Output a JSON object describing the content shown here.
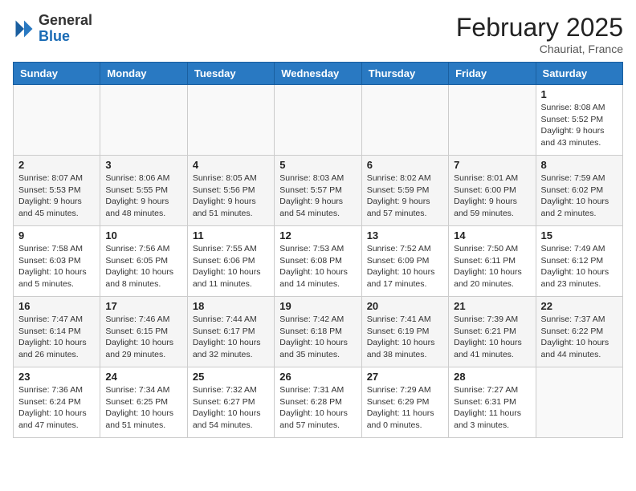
{
  "header": {
    "logo": {
      "general": "General",
      "blue": "Blue"
    },
    "title": "February 2025",
    "location": "Chauriat, France"
  },
  "weekdays": [
    "Sunday",
    "Monday",
    "Tuesday",
    "Wednesday",
    "Thursday",
    "Friday",
    "Saturday"
  ],
  "weeks": [
    [
      {
        "day": "",
        "info": ""
      },
      {
        "day": "",
        "info": ""
      },
      {
        "day": "",
        "info": ""
      },
      {
        "day": "",
        "info": ""
      },
      {
        "day": "",
        "info": ""
      },
      {
        "day": "",
        "info": ""
      },
      {
        "day": "1",
        "info": "Sunrise: 8:08 AM\nSunset: 5:52 PM\nDaylight: 9 hours and 43 minutes."
      }
    ],
    [
      {
        "day": "2",
        "info": "Sunrise: 8:07 AM\nSunset: 5:53 PM\nDaylight: 9 hours and 45 minutes."
      },
      {
        "day": "3",
        "info": "Sunrise: 8:06 AM\nSunset: 5:55 PM\nDaylight: 9 hours and 48 minutes."
      },
      {
        "day": "4",
        "info": "Sunrise: 8:05 AM\nSunset: 5:56 PM\nDaylight: 9 hours and 51 minutes."
      },
      {
        "day": "5",
        "info": "Sunrise: 8:03 AM\nSunset: 5:57 PM\nDaylight: 9 hours and 54 minutes."
      },
      {
        "day": "6",
        "info": "Sunrise: 8:02 AM\nSunset: 5:59 PM\nDaylight: 9 hours and 57 minutes."
      },
      {
        "day": "7",
        "info": "Sunrise: 8:01 AM\nSunset: 6:00 PM\nDaylight: 9 hours and 59 minutes."
      },
      {
        "day": "8",
        "info": "Sunrise: 7:59 AM\nSunset: 6:02 PM\nDaylight: 10 hours and 2 minutes."
      }
    ],
    [
      {
        "day": "9",
        "info": "Sunrise: 7:58 AM\nSunset: 6:03 PM\nDaylight: 10 hours and 5 minutes."
      },
      {
        "day": "10",
        "info": "Sunrise: 7:56 AM\nSunset: 6:05 PM\nDaylight: 10 hours and 8 minutes."
      },
      {
        "day": "11",
        "info": "Sunrise: 7:55 AM\nSunset: 6:06 PM\nDaylight: 10 hours and 11 minutes."
      },
      {
        "day": "12",
        "info": "Sunrise: 7:53 AM\nSunset: 6:08 PM\nDaylight: 10 hours and 14 minutes."
      },
      {
        "day": "13",
        "info": "Sunrise: 7:52 AM\nSunset: 6:09 PM\nDaylight: 10 hours and 17 minutes."
      },
      {
        "day": "14",
        "info": "Sunrise: 7:50 AM\nSunset: 6:11 PM\nDaylight: 10 hours and 20 minutes."
      },
      {
        "day": "15",
        "info": "Sunrise: 7:49 AM\nSunset: 6:12 PM\nDaylight: 10 hours and 23 minutes."
      }
    ],
    [
      {
        "day": "16",
        "info": "Sunrise: 7:47 AM\nSunset: 6:14 PM\nDaylight: 10 hours and 26 minutes."
      },
      {
        "day": "17",
        "info": "Sunrise: 7:46 AM\nSunset: 6:15 PM\nDaylight: 10 hours and 29 minutes."
      },
      {
        "day": "18",
        "info": "Sunrise: 7:44 AM\nSunset: 6:17 PM\nDaylight: 10 hours and 32 minutes."
      },
      {
        "day": "19",
        "info": "Sunrise: 7:42 AM\nSunset: 6:18 PM\nDaylight: 10 hours and 35 minutes."
      },
      {
        "day": "20",
        "info": "Sunrise: 7:41 AM\nSunset: 6:19 PM\nDaylight: 10 hours and 38 minutes."
      },
      {
        "day": "21",
        "info": "Sunrise: 7:39 AM\nSunset: 6:21 PM\nDaylight: 10 hours and 41 minutes."
      },
      {
        "day": "22",
        "info": "Sunrise: 7:37 AM\nSunset: 6:22 PM\nDaylight: 10 hours and 44 minutes."
      }
    ],
    [
      {
        "day": "23",
        "info": "Sunrise: 7:36 AM\nSunset: 6:24 PM\nDaylight: 10 hours and 47 minutes."
      },
      {
        "day": "24",
        "info": "Sunrise: 7:34 AM\nSunset: 6:25 PM\nDaylight: 10 hours and 51 minutes."
      },
      {
        "day": "25",
        "info": "Sunrise: 7:32 AM\nSunset: 6:27 PM\nDaylight: 10 hours and 54 minutes."
      },
      {
        "day": "26",
        "info": "Sunrise: 7:31 AM\nSunset: 6:28 PM\nDaylight: 10 hours and 57 minutes."
      },
      {
        "day": "27",
        "info": "Sunrise: 7:29 AM\nSunset: 6:29 PM\nDaylight: 11 hours and 0 minutes."
      },
      {
        "day": "28",
        "info": "Sunrise: 7:27 AM\nSunset: 6:31 PM\nDaylight: 11 hours and 3 minutes."
      },
      {
        "day": "",
        "info": ""
      }
    ]
  ]
}
